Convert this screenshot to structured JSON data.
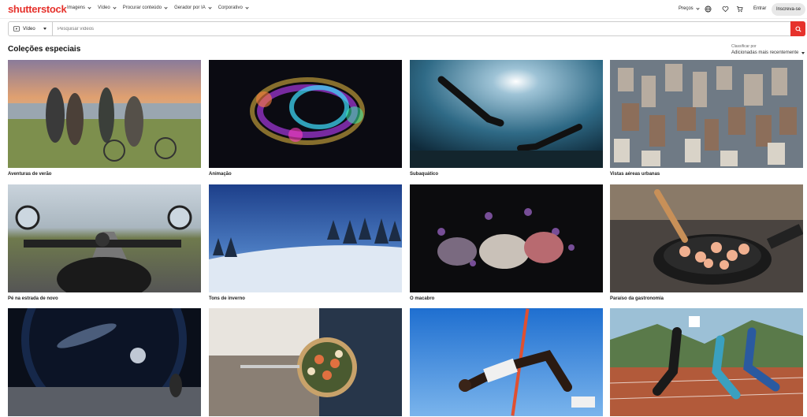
{
  "logo": "shutterstock",
  "nav": {
    "links": [
      "Imagens",
      "Vídeo",
      "Procurar conteúdo",
      "Gerador por IA",
      "Corporativo"
    ],
    "precos": "Preços",
    "entrar": "Entrar",
    "inscreva": "Inscreva-se"
  },
  "search": {
    "type_label": "Vídeo",
    "placeholder": "Pesquisar vídeos"
  },
  "section": {
    "title": "Coleções especiais",
    "sort_label": "Classificar por",
    "sort_value": "Adicionadas mais recentemente"
  },
  "collections": [
    {
      "label": "Aventuras de verão"
    },
    {
      "label": "Animação"
    },
    {
      "label": "Subaquático"
    },
    {
      "label": "Vistas aéreas urbanas"
    },
    {
      "label": "Pé na estrada de novo"
    },
    {
      "label": "Tons de inverno"
    },
    {
      "label": "O macabro"
    },
    {
      "label": "Paraíso da gastronomia"
    },
    {
      "label": ""
    },
    {
      "label": ""
    },
    {
      "label": ""
    },
    {
      "label": ""
    }
  ],
  "icons": [
    "video-icon",
    "search-icon",
    "globe-icon",
    "heart-icon",
    "cart-icon"
  ],
  "colors": {
    "brand": "#e6322c"
  }
}
